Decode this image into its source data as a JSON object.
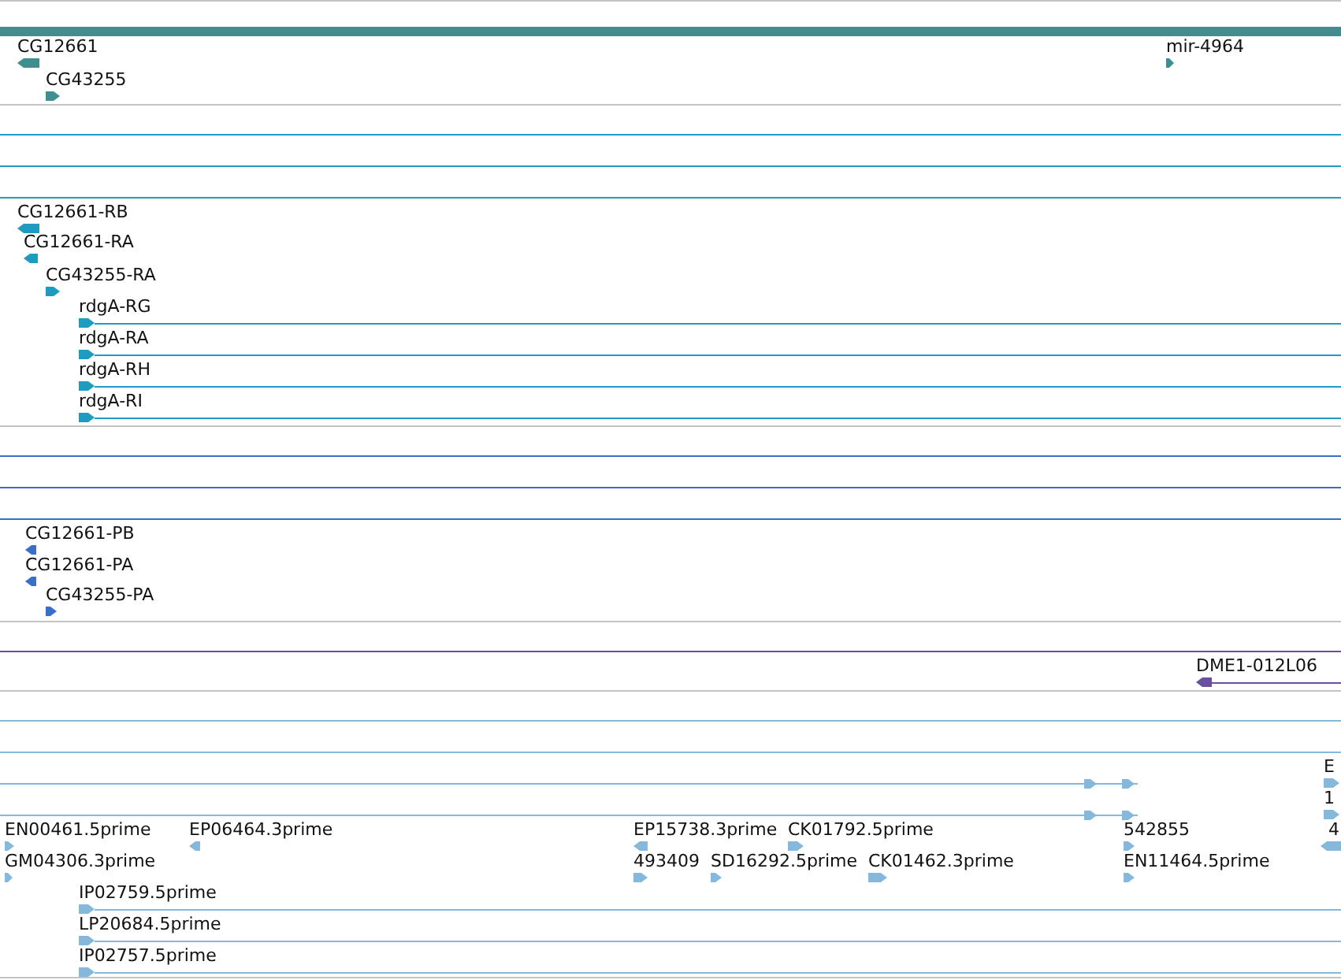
{
  "tracks": [
    {
      "color": "#3f8f91",
      "features": [
        {
          "label": "CG12661",
          "reverse": true,
          "continues": false
        },
        {
          "label": "CG43255",
          "reverse": false,
          "continues": false
        },
        {
          "label": "mir-4964",
          "reverse": false,
          "continues": false
        }
      ]
    },
    {
      "color": "#1e9bbf",
      "features": [
        {
          "label": "CG12661-RB",
          "reverse": true,
          "continues": false
        },
        {
          "label": "CG12661-RA",
          "reverse": true,
          "continues": false
        },
        {
          "label": "CG43255-RA",
          "reverse": false,
          "continues": false
        },
        {
          "label": "rdgA-RG",
          "reverse": false,
          "continues": true
        },
        {
          "label": "rdgA-RA",
          "reverse": false,
          "continues": true
        },
        {
          "label": "rdgA-RH",
          "reverse": false,
          "continues": true
        },
        {
          "label": "rdgA-RI",
          "reverse": false,
          "continues": true
        }
      ]
    },
    {
      "color": "#3a6fc8",
      "features": [
        {
          "label": "CG12661-PB",
          "reverse": true,
          "continues": false
        },
        {
          "label": "CG12661-PA",
          "reverse": true,
          "continues": false
        },
        {
          "label": "CG43255-PA",
          "reverse": false,
          "continues": false
        }
      ]
    },
    {
      "color": "#6a4fa0",
      "features": [
        {
          "label": "DME1-012L06",
          "reverse": true,
          "continues": true
        }
      ]
    },
    {
      "color": "#86b8dc",
      "features": [
        {
          "kind": "span",
          "reverse": false
        },
        {
          "label": "E",
          "reverse": false,
          "continues": false
        },
        {
          "kind": "span",
          "reverse": false
        },
        {
          "label": "1",
          "reverse": false,
          "continues": false
        },
        {
          "label": "EN00461.5prime",
          "reverse": false,
          "continues": false
        },
        {
          "label": "EP06464.3prime",
          "reverse": true,
          "continues": false
        },
        {
          "label": "EP15738.3prime",
          "reverse": true,
          "continues": false
        },
        {
          "label": "CK01792.5prime",
          "reverse": false,
          "continues": false
        },
        {
          "label": "542855",
          "reverse": false,
          "continues": false
        },
        {
          "label": "4",
          "reverse": true,
          "continues": false
        },
        {
          "label": "GM04306.3prime",
          "reverse": false,
          "continues": false
        },
        {
          "label": "493409",
          "reverse": false,
          "continues": false
        },
        {
          "label": "SD16292.5prime",
          "reverse": false,
          "continues": false
        },
        {
          "label": "CK01462.3prime",
          "reverse": false,
          "continues": false
        },
        {
          "label": "EN11464.5prime",
          "reverse": false,
          "continues": false
        },
        {
          "label": "IP02759.5prime",
          "reverse": false,
          "continues": true
        },
        {
          "label": "LP20684.5prime",
          "reverse": false,
          "continues": true
        },
        {
          "label": "IP02757.5prime",
          "reverse": false,
          "continues": true
        }
      ]
    }
  ]
}
